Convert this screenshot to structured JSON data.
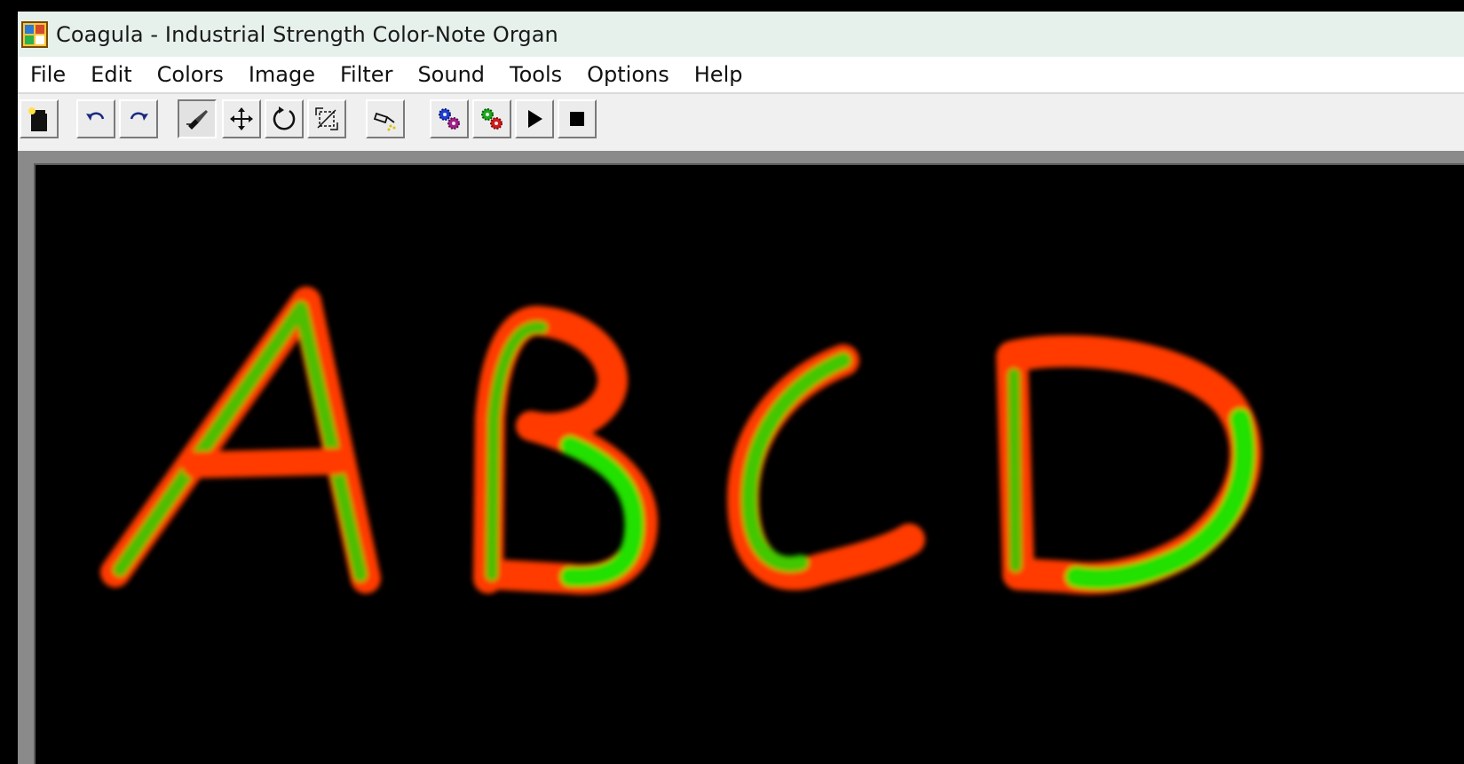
{
  "window": {
    "title": "Coagula - Industrial Strength Color-Note Organ"
  },
  "menu": {
    "items": [
      "File",
      "Edit",
      "Colors",
      "Image",
      "Filter",
      "Sound",
      "Tools",
      "Options",
      "Help"
    ]
  },
  "toolbar": {
    "buttons": [
      {
        "name": "new-image-button",
        "icon": "new-image-icon"
      },
      {
        "name": "undo-button",
        "icon": "undo-icon"
      },
      {
        "name": "redo-button",
        "icon": "redo-icon"
      },
      {
        "name": "brush-tool-button",
        "icon": "brush-icon",
        "pressed": true
      },
      {
        "name": "move-tool-button",
        "icon": "move-icon"
      },
      {
        "name": "rotate-tool-button",
        "icon": "rotate-icon"
      },
      {
        "name": "transform-tool-button",
        "icon": "transform-icon"
      },
      {
        "name": "spray-tool-button",
        "icon": "spray-icon"
      },
      {
        "name": "render-button",
        "icon": "gears-blue-icon"
      },
      {
        "name": "render-all-button",
        "icon": "gears-red-icon"
      },
      {
        "name": "play-button",
        "icon": "play-icon"
      },
      {
        "name": "stop-button",
        "icon": "stop-icon"
      }
    ]
  },
  "canvas": {
    "background": "#000000",
    "stroke_colors": [
      "#ff3a00",
      "#22e000"
    ]
  }
}
